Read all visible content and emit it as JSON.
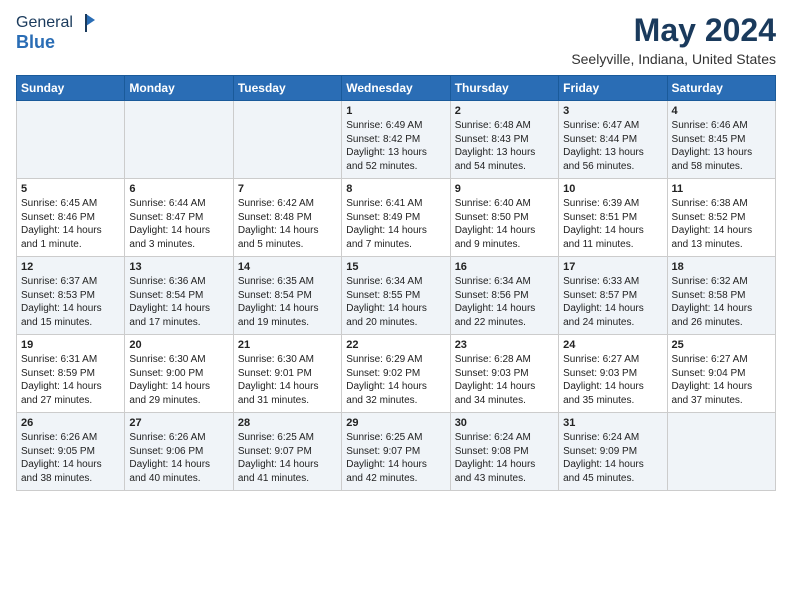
{
  "logo": {
    "general": "General",
    "blue": "Blue"
  },
  "title": "May 2024",
  "subtitle": "Seelyville, Indiana, United States",
  "headers": [
    "Sunday",
    "Monday",
    "Tuesday",
    "Wednesday",
    "Thursday",
    "Friday",
    "Saturday"
  ],
  "weeks": [
    [
      {
        "day": "",
        "info": ""
      },
      {
        "day": "",
        "info": ""
      },
      {
        "day": "",
        "info": ""
      },
      {
        "day": "1",
        "info": "Sunrise: 6:49 AM\nSunset: 8:42 PM\nDaylight: 13 hours and 52 minutes."
      },
      {
        "day": "2",
        "info": "Sunrise: 6:48 AM\nSunset: 8:43 PM\nDaylight: 13 hours and 54 minutes."
      },
      {
        "day": "3",
        "info": "Sunrise: 6:47 AM\nSunset: 8:44 PM\nDaylight: 13 hours and 56 minutes."
      },
      {
        "day": "4",
        "info": "Sunrise: 6:46 AM\nSunset: 8:45 PM\nDaylight: 13 hours and 58 minutes."
      }
    ],
    [
      {
        "day": "5",
        "info": "Sunrise: 6:45 AM\nSunset: 8:46 PM\nDaylight: 14 hours and 1 minute."
      },
      {
        "day": "6",
        "info": "Sunrise: 6:44 AM\nSunset: 8:47 PM\nDaylight: 14 hours and 3 minutes."
      },
      {
        "day": "7",
        "info": "Sunrise: 6:42 AM\nSunset: 8:48 PM\nDaylight: 14 hours and 5 minutes."
      },
      {
        "day": "8",
        "info": "Sunrise: 6:41 AM\nSunset: 8:49 PM\nDaylight: 14 hours and 7 minutes."
      },
      {
        "day": "9",
        "info": "Sunrise: 6:40 AM\nSunset: 8:50 PM\nDaylight: 14 hours and 9 minutes."
      },
      {
        "day": "10",
        "info": "Sunrise: 6:39 AM\nSunset: 8:51 PM\nDaylight: 14 hours and 11 minutes."
      },
      {
        "day": "11",
        "info": "Sunrise: 6:38 AM\nSunset: 8:52 PM\nDaylight: 14 hours and 13 minutes."
      }
    ],
    [
      {
        "day": "12",
        "info": "Sunrise: 6:37 AM\nSunset: 8:53 PM\nDaylight: 14 hours and 15 minutes."
      },
      {
        "day": "13",
        "info": "Sunrise: 6:36 AM\nSunset: 8:54 PM\nDaylight: 14 hours and 17 minutes."
      },
      {
        "day": "14",
        "info": "Sunrise: 6:35 AM\nSunset: 8:54 PM\nDaylight: 14 hours and 19 minutes."
      },
      {
        "day": "15",
        "info": "Sunrise: 6:34 AM\nSunset: 8:55 PM\nDaylight: 14 hours and 20 minutes."
      },
      {
        "day": "16",
        "info": "Sunrise: 6:34 AM\nSunset: 8:56 PM\nDaylight: 14 hours and 22 minutes."
      },
      {
        "day": "17",
        "info": "Sunrise: 6:33 AM\nSunset: 8:57 PM\nDaylight: 14 hours and 24 minutes."
      },
      {
        "day": "18",
        "info": "Sunrise: 6:32 AM\nSunset: 8:58 PM\nDaylight: 14 hours and 26 minutes."
      }
    ],
    [
      {
        "day": "19",
        "info": "Sunrise: 6:31 AM\nSunset: 8:59 PM\nDaylight: 14 hours and 27 minutes."
      },
      {
        "day": "20",
        "info": "Sunrise: 6:30 AM\nSunset: 9:00 PM\nDaylight: 14 hours and 29 minutes."
      },
      {
        "day": "21",
        "info": "Sunrise: 6:30 AM\nSunset: 9:01 PM\nDaylight: 14 hours and 31 minutes."
      },
      {
        "day": "22",
        "info": "Sunrise: 6:29 AM\nSunset: 9:02 PM\nDaylight: 14 hours and 32 minutes."
      },
      {
        "day": "23",
        "info": "Sunrise: 6:28 AM\nSunset: 9:03 PM\nDaylight: 14 hours and 34 minutes."
      },
      {
        "day": "24",
        "info": "Sunrise: 6:27 AM\nSunset: 9:03 PM\nDaylight: 14 hours and 35 minutes."
      },
      {
        "day": "25",
        "info": "Sunrise: 6:27 AM\nSunset: 9:04 PM\nDaylight: 14 hours and 37 minutes."
      }
    ],
    [
      {
        "day": "26",
        "info": "Sunrise: 6:26 AM\nSunset: 9:05 PM\nDaylight: 14 hours and 38 minutes."
      },
      {
        "day": "27",
        "info": "Sunrise: 6:26 AM\nSunset: 9:06 PM\nDaylight: 14 hours and 40 minutes."
      },
      {
        "day": "28",
        "info": "Sunrise: 6:25 AM\nSunset: 9:07 PM\nDaylight: 14 hours and 41 minutes."
      },
      {
        "day": "29",
        "info": "Sunrise: 6:25 AM\nSunset: 9:07 PM\nDaylight: 14 hours and 42 minutes."
      },
      {
        "day": "30",
        "info": "Sunrise: 6:24 AM\nSunset: 9:08 PM\nDaylight: 14 hours and 43 minutes."
      },
      {
        "day": "31",
        "info": "Sunrise: 6:24 AM\nSunset: 9:09 PM\nDaylight: 14 hours and 45 minutes."
      },
      {
        "day": "",
        "info": ""
      }
    ]
  ]
}
